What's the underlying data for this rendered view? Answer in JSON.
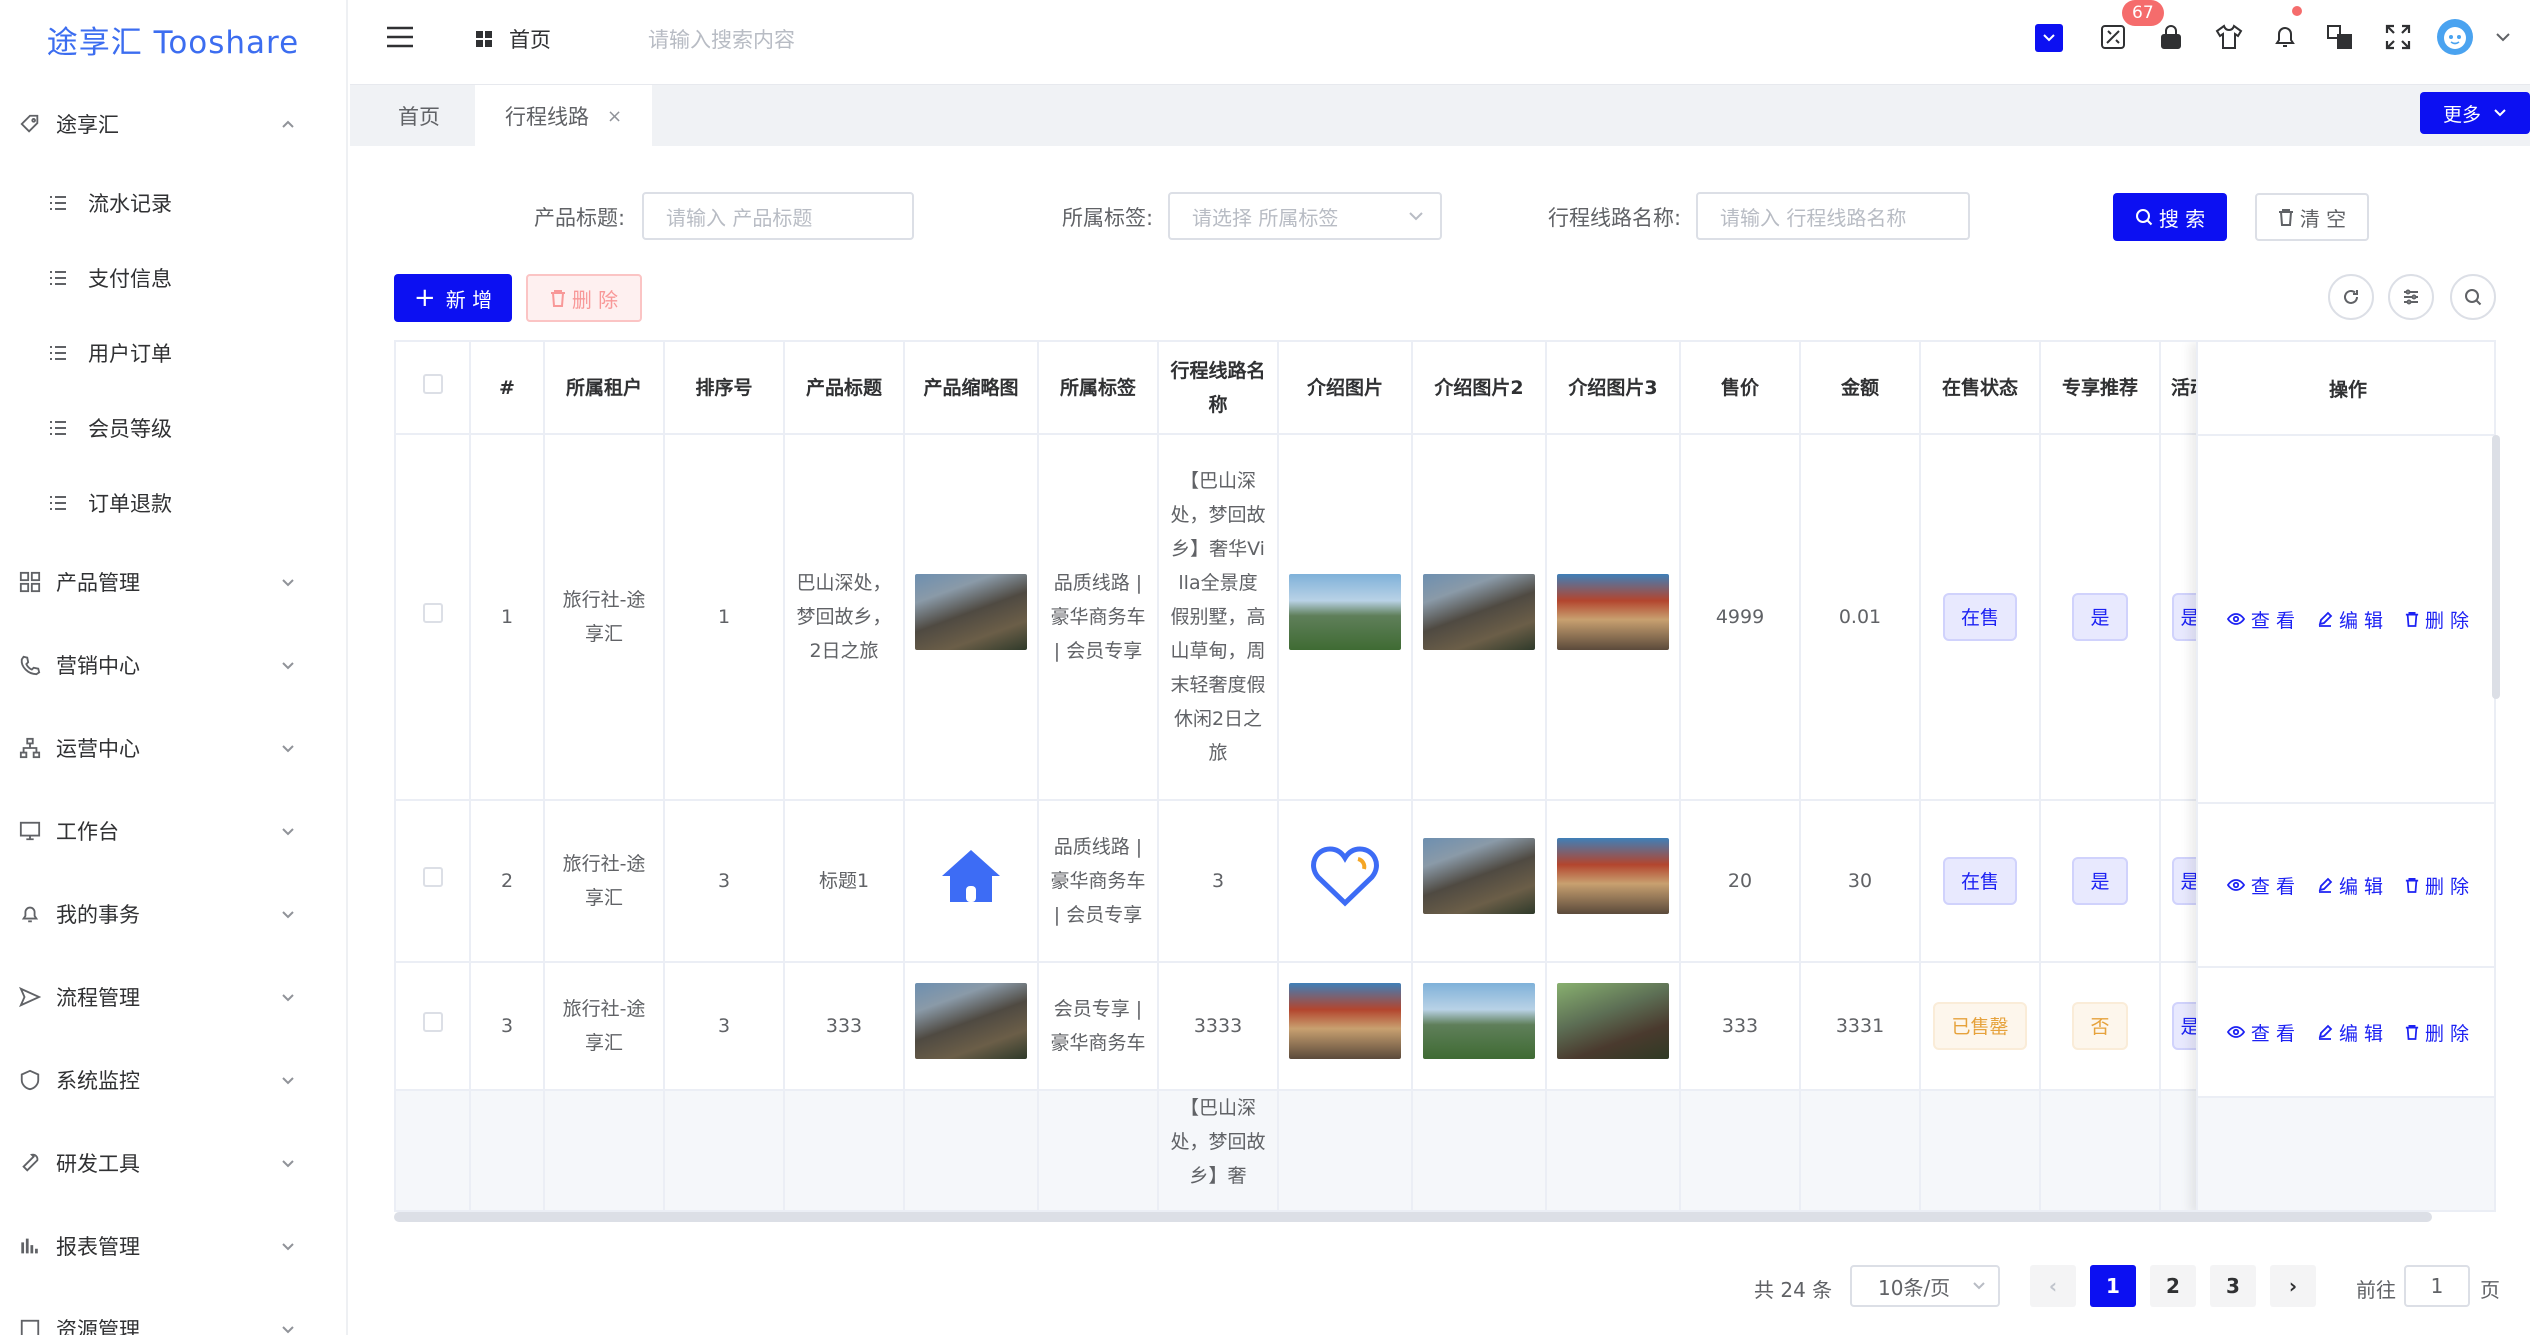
{
  "brand": {
    "logo": "途享汇 Tooshare"
  },
  "sidebar": {
    "group_open": "途享汇",
    "subitems": [
      "流水记录",
      "支付信息",
      "用户订单",
      "会员等级",
      "订单退款"
    ],
    "groups": [
      "产品管理",
      "营销中心",
      "运营中心",
      "工作台",
      "我的事务",
      "流程管理",
      "系统监控",
      "研发工具",
      "报表管理",
      "资源管理"
    ]
  },
  "header": {
    "breadcrumb": "首页",
    "search_placeholder": "请输入搜索内容",
    "badge_count": "67"
  },
  "tabs": {
    "home": "首页",
    "current": "行程线路",
    "close": "×",
    "more": "更多"
  },
  "filters": {
    "title_label": "产品标题:",
    "title_placeholder": "请输入 产品标题",
    "tag_label": "所属标签:",
    "tag_placeholder": "请选择 所属标签",
    "route_label": "行程线路名称:",
    "route_placeholder": "请输入 行程线路名称",
    "search": "搜 索",
    "clear": "清 空"
  },
  "toolbar": {
    "add": "新 增",
    "delete": "删 除"
  },
  "table": {
    "headers": [
      "#",
      "所属租户",
      "排序号",
      "产品标题",
      "产品缩略图",
      "所属标签",
      "行程线路名称",
      "介绍图片",
      "介绍图片2",
      "介绍图片3",
      "售价",
      "金额",
      "在售状态",
      "专享推荐",
      "活动",
      "操作"
    ],
    "rows": [
      {
        "idx": "1",
        "tenant": "旅行社-途享汇",
        "sort": "1",
        "title": "巴山深处，梦回故乡，2日之旅",
        "tags": "品质线路 | 豪华商务车 | 会员专享",
        "route": "【巴山深处，梦回故乡】奢华Villa全景度假别墅，高山草甸，周末轻奢度假休闲2日之旅",
        "price": "4999",
        "amount": "0.01",
        "status": "在售",
        "recommend": "是",
        "activity": "是"
      },
      {
        "idx": "2",
        "tenant": "旅行社-途享汇",
        "sort": "3",
        "title": "标题1",
        "tags": "品质线路 | 豪华商务车 | 会员专享",
        "route": "3",
        "price": "20",
        "amount": "30",
        "status": "在售",
        "recommend": "是",
        "activity": "是"
      },
      {
        "idx": "3",
        "tenant": "旅行社-途享汇",
        "sort": "3",
        "title": "333",
        "tags": "会员专享 | 豪华商务车",
        "route": "3333",
        "price": "333",
        "amount": "3331",
        "status": "已售罄",
        "recommend": "否",
        "activity": "是"
      },
      {
        "idx": "",
        "tenant": "",
        "sort": "",
        "title": "",
        "tags": "",
        "route": "【巴山深处，梦回故乡】奢",
        "price": "",
        "amount": "",
        "status": "",
        "recommend": "",
        "activity": ""
      }
    ],
    "ops": {
      "view": "查 看",
      "edit": "编 辑",
      "delete": "删 除"
    }
  },
  "pagination": {
    "total": "共 24 条",
    "page_size": "10条/页",
    "pages": [
      "1",
      "2",
      "3"
    ],
    "goto_label": "前往",
    "goto_value": "1",
    "page_unit": "页"
  }
}
